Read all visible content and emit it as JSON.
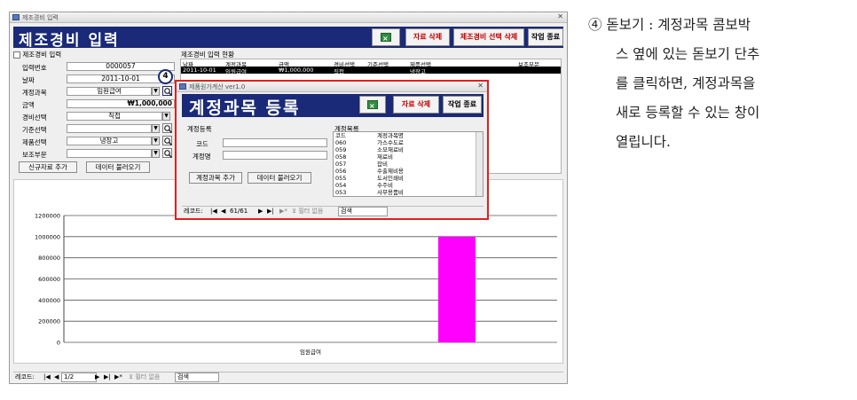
{
  "main_window": {
    "title": "제조경비 입력",
    "header_title": "제조경비 입력",
    "toolbar": {
      "delete_label": "자료 삭제",
      "delete_selected_label": "제조경비 선택 삭제",
      "close_label": "작업 종료"
    },
    "form_caption": "제조경비 입력",
    "fields": {
      "input_no": {
        "label": "입력번호",
        "value": "0000057"
      },
      "date": {
        "label": "날짜",
        "value": "2011-10-01"
      },
      "account": {
        "label": "계정과목",
        "value": "임원급여"
      },
      "amount": {
        "label": "금액",
        "value": "₩1,000,000"
      },
      "expense_sel": {
        "label": "경비선택",
        "value": "직접"
      },
      "criteria_sel": {
        "label": "기준선택",
        "value": ""
      },
      "product_sel": {
        "label": "제품선택",
        "value": "냉장고"
      },
      "aux_dept": {
        "label": "보조부문",
        "value": ""
      }
    },
    "buttons": {
      "new_record": "신규자료 추가",
      "load_data": "데이터 불러오기"
    },
    "grid": {
      "caption": "제조경비 입력 현황",
      "headers": [
        "날짜",
        "계정과목",
        "금액",
        "경비선택",
        "기준선택",
        "제품선택",
        "보조부문"
      ],
      "rows": [
        [
          "2011-10-01",
          "임원급여",
          "₩1,000,000",
          "직접",
          "",
          "냉장고",
          ""
        ]
      ]
    },
    "navbar": {
      "record_label": "레코드:",
      "position": "1/2",
      "filter": "필터 없음",
      "search": "검색"
    }
  },
  "chart_data": {
    "type": "bar",
    "categories": [
      "임원급여"
    ],
    "values": [
      1000000
    ],
    "ylim": [
      0,
      1200000
    ],
    "yticks": [
      "0",
      "200000",
      "400000",
      "600000",
      "800000",
      "1000000",
      "1200000"
    ],
    "color": "#ff00ff",
    "grid": true,
    "title": "",
    "xlabel": "",
    "ylabel": ""
  },
  "callout_number": "4",
  "popup": {
    "title": "제품원가계산 ver1.0",
    "header_title": "계정과목 등록",
    "toolbar": {
      "delete_label": "자료 삭제",
      "close_label": "작업 종료"
    },
    "form_caption": "계정등록",
    "code_label": "코드",
    "name_label": "계정명",
    "buttons": {
      "add": "계정과목 추가",
      "load": "데이터 불러오기"
    },
    "list": {
      "caption": "계정목록",
      "headers": [
        "코드",
        "계정과목명"
      ],
      "rows": [
        [
          "060",
          "가스수도료"
        ],
        [
          "059",
          "소모재료비"
        ],
        [
          "058",
          "재료비"
        ],
        [
          "057",
          "잡비"
        ],
        [
          "056",
          "수출제비용"
        ],
        [
          "055",
          "도서인쇄비"
        ],
        [
          "054",
          "수주비"
        ],
        [
          "053",
          "사무용품비"
        ]
      ]
    },
    "navbar": {
      "record_label": "레코드:",
      "position": "61/61",
      "filter": "필터 없음",
      "search": "검색"
    }
  },
  "instruction": {
    "lines": [
      "④ 돋보기 : 계정과목 콤보박",
      "스 옆에 있는 돋보기 단추",
      "를 클릭하면, 계정과목을",
      "새로 등록할 수 있는 창이",
      "열립니다."
    ]
  },
  "colors": {
    "header_bg": "#1a2a78",
    "highlight_border": "#e02020",
    "bar": "#ff00ff",
    "danger_text": "#c00000"
  }
}
